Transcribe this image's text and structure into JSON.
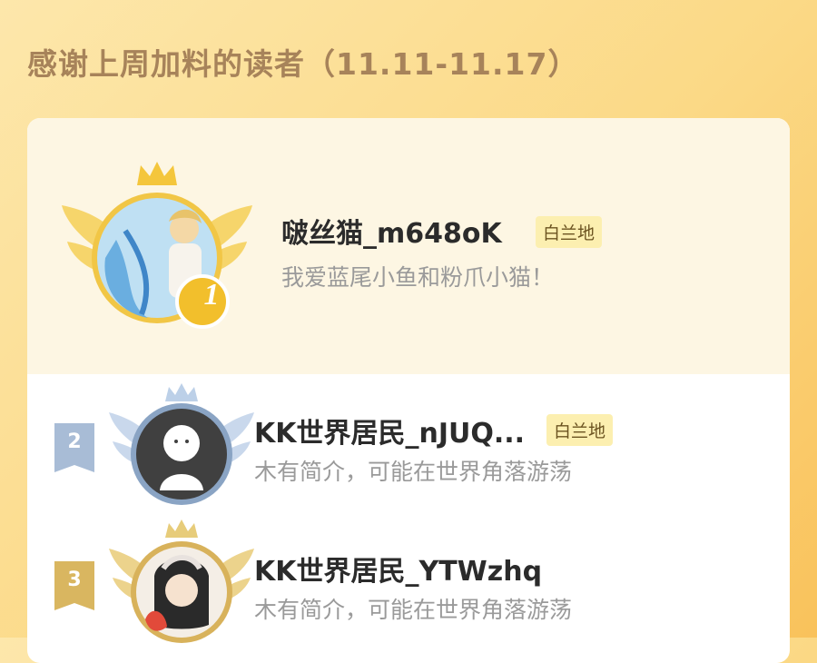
{
  "header": {
    "title": "感谢上周加料的读者（11.11-11.17）"
  },
  "readers": [
    {
      "rank": "1",
      "name": "啵丝猫_m648oK",
      "tag": "白兰地",
      "description": "我爱蓝尾小鱼和粉爪小猫！"
    },
    {
      "rank": "2",
      "name": "KK世界居民_nJUQ...",
      "tag": "白兰地",
      "description": "木有简介，可能在世界角落游荡"
    },
    {
      "rank": "3",
      "name": "KK世界居民_YTWzhq",
      "tag": "",
      "description": "木有简介，可能在世界角落游荡"
    }
  ],
  "colors": {
    "accent_gold": "#f3c23a",
    "silver": "#9db2cc",
    "bronze": "#d8b25b"
  }
}
